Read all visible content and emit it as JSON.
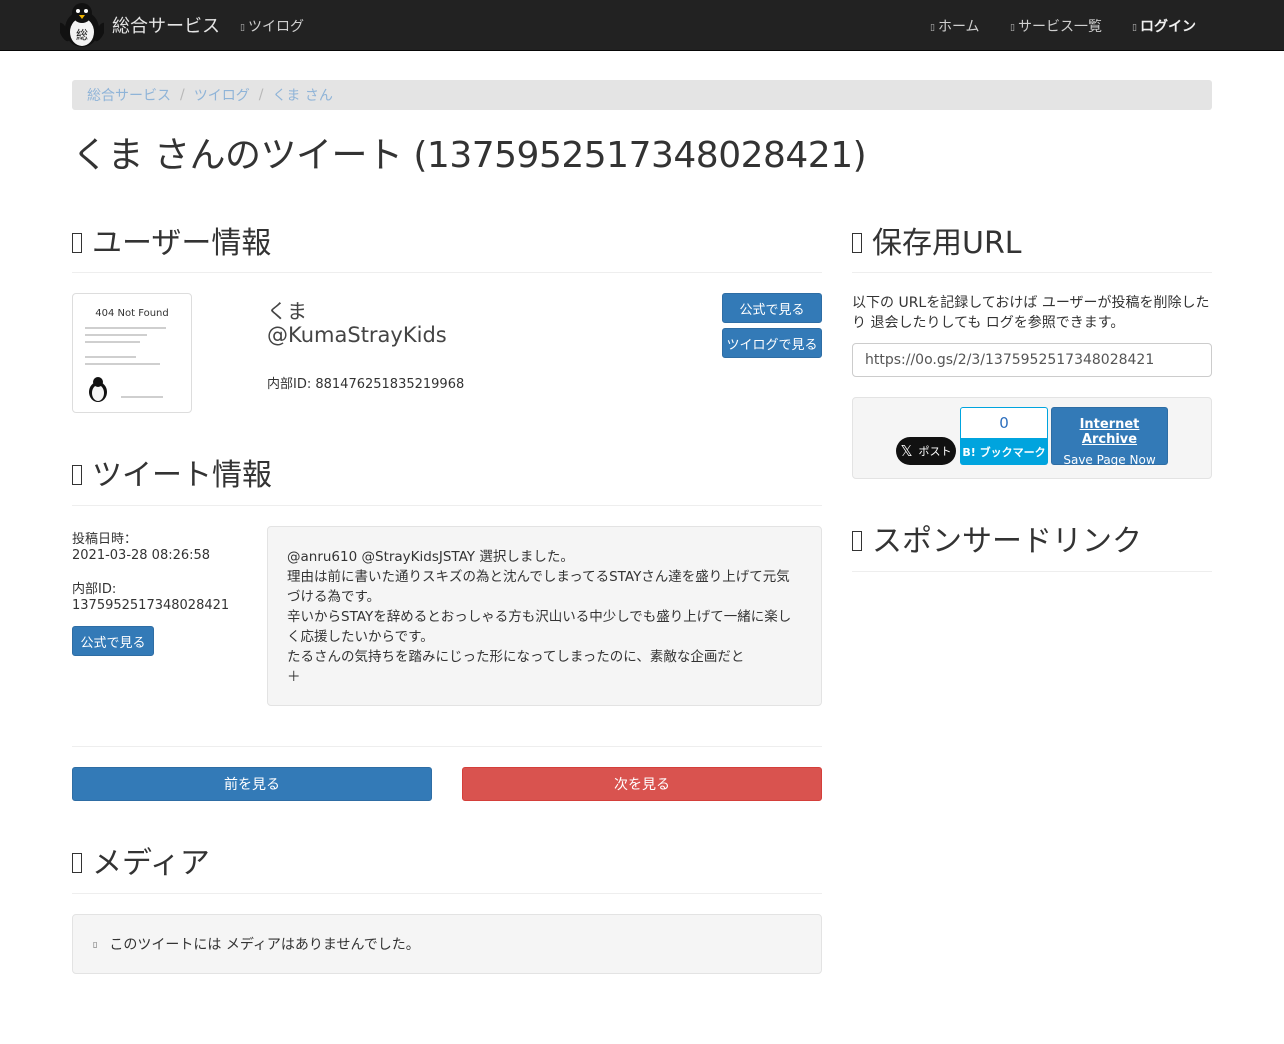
{
  "nav": {
    "brand": "総合サービス",
    "twilog": "ツイログ",
    "home": "ホーム",
    "services": "サービス一覧",
    "login": "ログイン"
  },
  "breadcrumb": [
    "総合サービス",
    "ツイログ",
    "くま さん"
  ],
  "page_title": "くま さんのツイート (1375952517348028421)",
  "user_section": {
    "heading": "ユーザー情報",
    "avatar_text": "404 Not Found",
    "name": "くま",
    "handle": "@KumaStrayKids",
    "internal_id": "内部ID: 881476251835219968",
    "btn_official": "公式で見る",
    "btn_twilog": "ツイログで見る"
  },
  "tweet_section": {
    "heading": "ツイート情報",
    "posted_label": "投稿日時：",
    "posted_value": "2021-03-28 08:26:58",
    "id_label": "内部ID:",
    "id_value": "1375952517348028421",
    "btn_official": "公式で見る",
    "lines": [
      "@anru610 @StrayKidsJSTAY 選択しました。",
      "理由は前に書いた通りスキズの為と沈んでしまってるSTAYさん達を盛り上げて元気づける為です。",
      "辛いからSTAYを辞めるとおっしゃる方も沢山いる中少しでも盛り上げて一緒に楽しく応援したいからです。",
      "たるさんの気持ちを踏みにじった形になってしまったのに、素敵な企画だと",
      "＋"
    ]
  },
  "pager": {
    "prev": "前を見る",
    "next": "次を見る"
  },
  "media_section": {
    "heading": "メディア",
    "empty_message": "このツイートには メディアはありませんでした。"
  },
  "save_section": {
    "heading": "保存用URL",
    "note": "以下の URLを記録しておけば ユーザーが投稿を削除したり 退会したりしても ログを参照できます。",
    "url": "https://0o.gs/2/3/1375952517348028421",
    "x_post": "ポスト",
    "hatena_count": "0",
    "hatena_label": "B! ブックマーク",
    "ia_title": "Internet Archive",
    "ia_sub": "Save Page Now"
  },
  "sponsor_section": {
    "heading": "スポンサードリンク"
  },
  "colors": {
    "navbar": "#222222",
    "primary": "#337ab7",
    "danger": "#d9534f",
    "hatena": "#00a4de"
  }
}
